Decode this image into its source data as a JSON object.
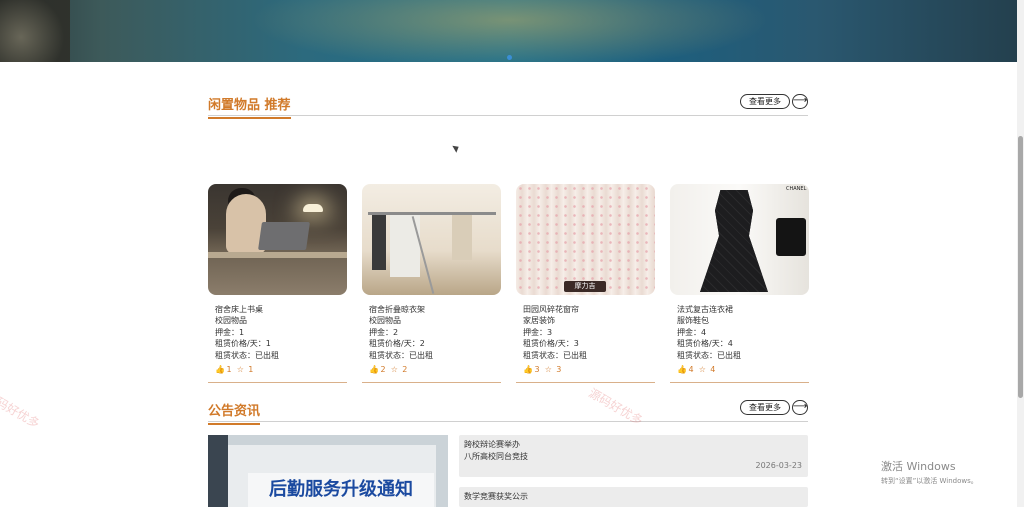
{
  "recommend": {
    "title": "闲置物品 推荐",
    "more_label": "查看更多",
    "more_arrow": "⟶",
    "items": [
      {
        "name": "宿舍床上书桌",
        "category": "校园物品",
        "deposit": "押金：1",
        "price": "租赁价格/天：1",
        "status": "租赁状态：已出租",
        "likes": "1",
        "favorites": "1"
      },
      {
        "name": "宿舍折叠晾衣架",
        "category": "校园物品",
        "deposit": "押金：2",
        "price": "租赁价格/天：2",
        "status": "租赁状态：已出租",
        "likes": "2",
        "favorites": "2"
      },
      {
        "name": "田园风碎花窗帘",
        "category": "家居装饰",
        "deposit": "押金：3",
        "price": "租赁价格/天：3",
        "status": "租赁状态：已出租",
        "likes": "3",
        "favorites": "3"
      },
      {
        "name": "法式复古连衣裙",
        "category": "服饰鞋包",
        "deposit": "押金：4",
        "price": "租赁价格/天：4",
        "status": "租赁状态：已出租",
        "likes": "4",
        "favorites": "4"
      }
    ]
  },
  "images": {
    "curtain_brand": "摩力吉",
    "dress_brand": "CHANEL"
  },
  "announce": {
    "title": "公告资讯",
    "more_label": "查看更多",
    "more_arrow": "⟶",
    "image_text": "后勤服务升级通知",
    "news": [
      {
        "title": "跨校辩论赛举办",
        "summary": "八所高校同台竞技",
        "date": "2026-03-23"
      },
      {
        "title": "数学竞赛获奖公示",
        "summary": "",
        "date": ""
      }
    ]
  },
  "watermark": "源码好优多",
  "watermark_partial": "码好优多",
  "windows_activate": {
    "line1": "激活 Windows",
    "line2": "转到“设置”以激活 Windows。"
  },
  "icons": {
    "like": "thumbs-up-icon",
    "favorite": "star-icon"
  },
  "colors": {
    "accent": "#d17a2a",
    "divider": "#d9b08a"
  }
}
